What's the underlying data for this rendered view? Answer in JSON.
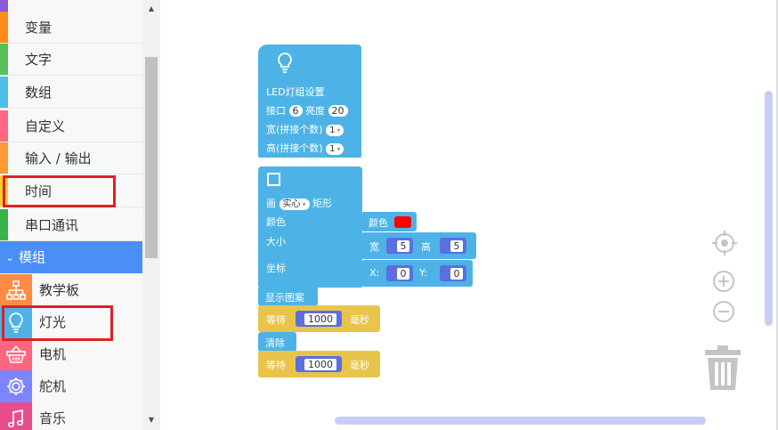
{
  "sidebar": {
    "categories": [
      {
        "label": "变量",
        "color": "#ff8c1a"
      },
      {
        "label": "文字",
        "color": "#59c059"
      },
      {
        "label": "数组",
        "color": "#4cbfe6"
      },
      {
        "label": "自定义",
        "color": "#ff6680"
      },
      {
        "label": "输入 / 输出",
        "color": "#ff9933"
      },
      {
        "label": "时间",
        "color": "#ffcc33"
      },
      {
        "label": "串口通讯",
        "color": "#37b34a"
      }
    ],
    "module_header": {
      "label": "模组",
      "chevron": "⌄"
    },
    "modules": [
      {
        "label": "教学板",
        "icon": "board-icon",
        "color": "#ff8c42"
      },
      {
        "label": "灯光",
        "icon": "bulb-icon",
        "color": "#4db3e6"
      },
      {
        "label": "电机",
        "icon": "basket-icon",
        "color": "#ff6680"
      },
      {
        "label": "舵机",
        "icon": "gear-icon",
        "color": "#7c84ff"
      },
      {
        "label": "音乐",
        "icon": "music-icon",
        "color": "#e84d8a"
      }
    ]
  },
  "blocks": {
    "led_setup": {
      "title": "LED灯组设置",
      "port_label": "接口",
      "port_value": "6",
      "brightness_label": "亮度",
      "brightness_value": "20",
      "width_label": "宽(拼接个数)",
      "width_value": "1",
      "height_label": "高(拼接个数)",
      "height_value": "1"
    },
    "draw_rect": {
      "draw_label": "画",
      "fill_value": "实心",
      "shape_label": "矩形",
      "color_label": "颜色",
      "size_label": "大小",
      "coord_label": "坐标",
      "color_input_label": "颜色",
      "color_value": "#ff0000",
      "width_label": "宽",
      "width_value": "5",
      "height_label": "高",
      "height_value": "5",
      "x_label": "X:",
      "x_value": "0",
      "y_label": "Y:",
      "y_value": "0"
    },
    "show_pattern": {
      "label": "显示图案"
    },
    "wait1": {
      "label": "等待",
      "value": "1000",
      "unit": "毫秒"
    },
    "clear": {
      "label": "清除"
    },
    "wait2": {
      "label": "等待",
      "value": "1000",
      "unit": "毫秒"
    }
  },
  "colors": {
    "blue_block": "#4db3e6",
    "yellow_block": "#e8c44a",
    "highlight": "#e01f26"
  }
}
